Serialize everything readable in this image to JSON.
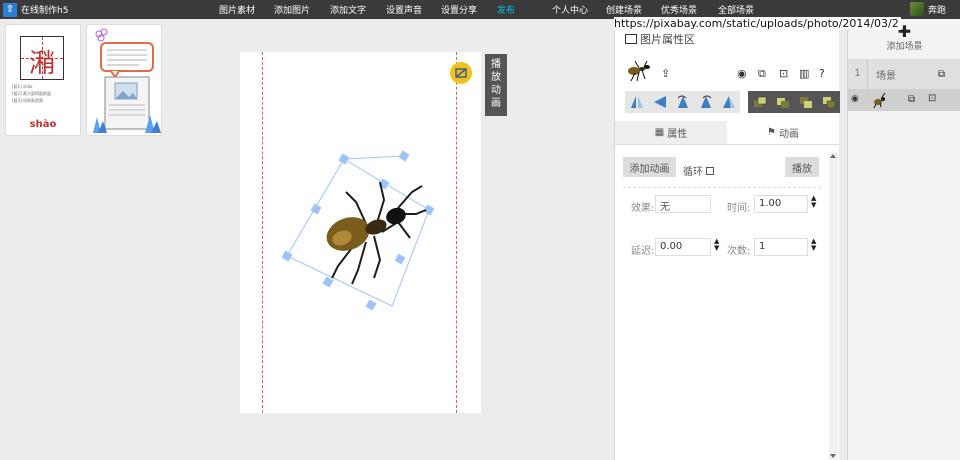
{
  "app": {
    "title": "在线制作h5",
    "logo_glyph": "⇧"
  },
  "nav": {
    "items": [
      "图片素材",
      "添加图片",
      "添加文字",
      "设置声音",
      "设置分享",
      "发布",
      "个人中心",
      "创建场景",
      "优秀场景",
      "全部场景"
    ],
    "active_color": "#00c0e0"
  },
  "user": {
    "name": "奔跑"
  },
  "thumbs": {
    "hanzi": "潲",
    "pinyin": "shào",
    "lines": [
      "[组1] shāo",
      "[组2] 蒸大部四面阴湿",
      "[组3] 风吹雨洒落"
    ]
  },
  "canvas": {
    "play_label": "播放动画"
  },
  "url_overlay": "https://pixabay.com/static/uploads/photo/2014/03/2",
  "panel": {
    "title": "图片属性区",
    "tabs": {
      "props": "属性",
      "anim": "动画"
    },
    "add_anim_label": "添加动画",
    "loop_label": "循环",
    "play_label": "播放",
    "effect_label": "效果:",
    "effect_value": "无",
    "time_label": "时间:",
    "time_value": "1.00",
    "delay_label": "延迟:",
    "delay_value": "0.00",
    "count_label": "次数:",
    "count_value": "1"
  },
  "scenes": {
    "add_label": "添加场景",
    "scene_number": "1",
    "scene_label": "场景"
  },
  "colors": {
    "topbar": "#3a3a3a",
    "accent_blue": "#2d7ed6",
    "selection": "#9ec4f5",
    "guide": "#e06060"
  }
}
